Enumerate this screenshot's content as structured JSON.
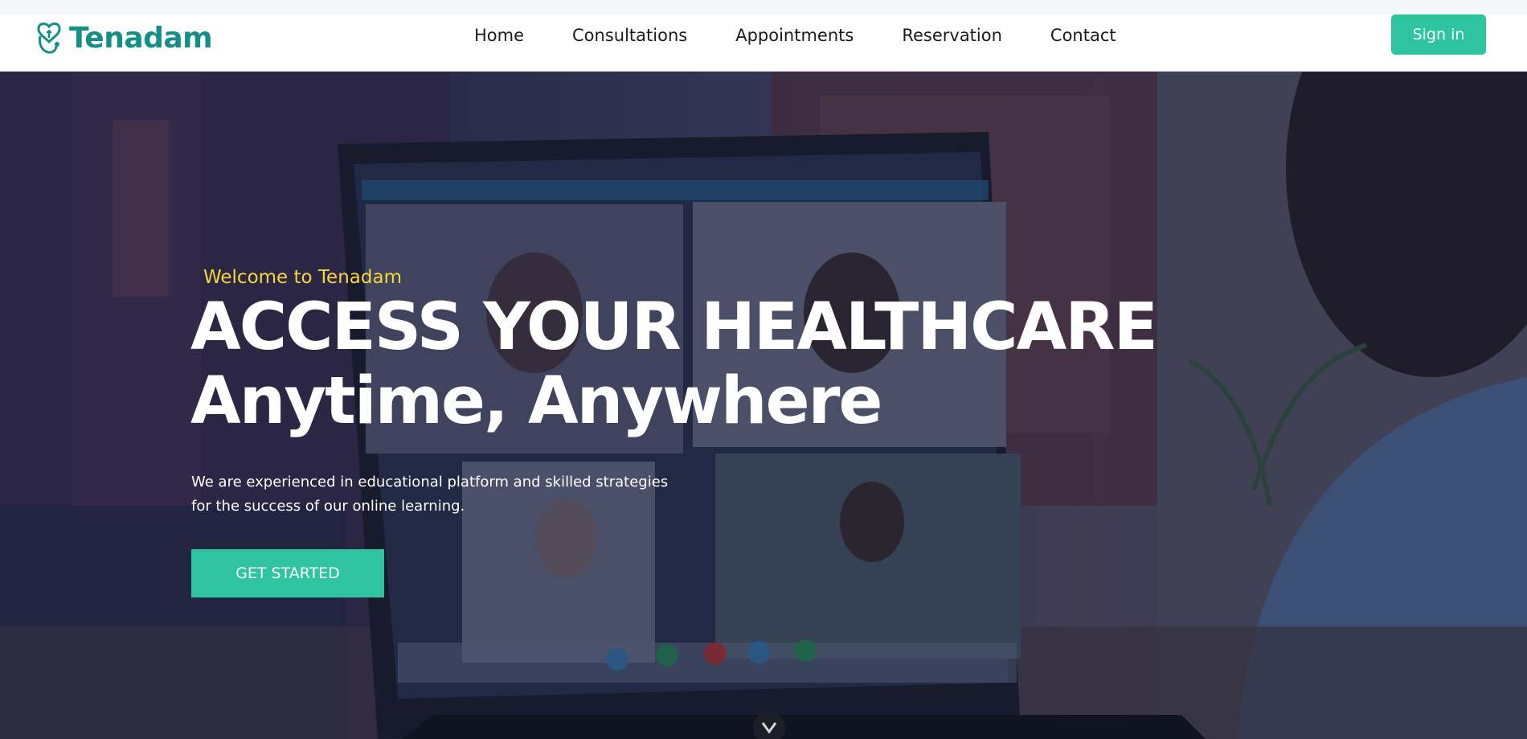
{
  "brand": {
    "name": "Tenadam",
    "color": "#148f86",
    "logo_icon": "stethoscope-heart-icon"
  },
  "nav": {
    "items": [
      {
        "label": "Home"
      },
      {
        "label": "Consultations"
      },
      {
        "label": "Appointments"
      },
      {
        "label": "Reservation"
      },
      {
        "label": "Contact"
      }
    ],
    "signin_label": "Sign in"
  },
  "hero": {
    "welcome": "Welcome to Tenadam",
    "headline_line1": "ACCESS YOUR HEALTHCARE",
    "headline_line2": "Anytime, Anywhere",
    "subtext_line1": "We are experienced in educational platform and skilled strategies",
    "subtext_line2": "for the success of our online learning.",
    "cta_label": "GET STARTED",
    "scroll_icon": "chevron-down-icon"
  },
  "colors": {
    "accent": "#2ec4a0",
    "welcome_text": "#f4d73a",
    "brand": "#148f86"
  }
}
